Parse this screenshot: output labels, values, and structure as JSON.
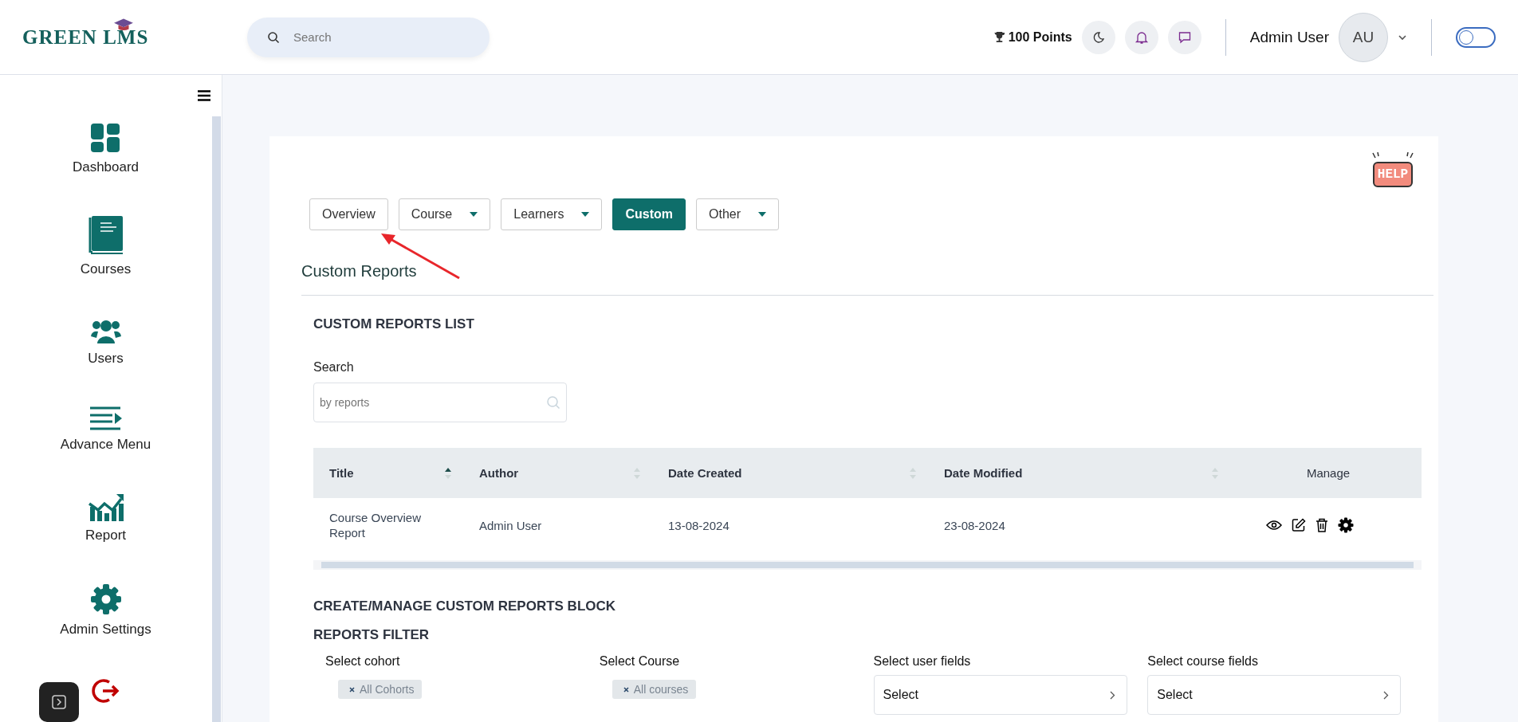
{
  "header": {
    "logo": "GREEN LMS",
    "search": {
      "placeholder": "Search"
    },
    "points": "100 Points",
    "user_name": "Admin User",
    "avatar_initials": "AU",
    "dark_mode_toggle": {
      "on": false
    }
  },
  "sidebar": {
    "items": [
      {
        "label": "Dashboard"
      },
      {
        "label": "Courses"
      },
      {
        "label": "Users"
      },
      {
        "label": "Advance Menu"
      },
      {
        "label": "Report"
      },
      {
        "label": "Admin Settings"
      }
    ]
  },
  "help_badge": "HELP",
  "tabs": [
    {
      "label": "Overview",
      "dropdown": false,
      "selected": false
    },
    {
      "label": "Course",
      "dropdown": true,
      "selected": false
    },
    {
      "label": "Learners",
      "dropdown": true,
      "selected": false
    },
    {
      "label": "Custom",
      "dropdown": false,
      "selected": true
    },
    {
      "label": "Other",
      "dropdown": true,
      "selected": false
    }
  ],
  "page_title": "Custom Reports",
  "list_heading": "CUSTOM REPORTS LIST",
  "search": {
    "label": "Search",
    "placeholder": "by reports"
  },
  "table": {
    "columns": [
      {
        "label": "Title",
        "sorted": true
      },
      {
        "label": "Author",
        "sorted": false
      },
      {
        "label": "Date Created",
        "sorted": false
      },
      {
        "label": "Date Modified",
        "sorted": false
      },
      {
        "label": "Manage"
      }
    ],
    "rows": [
      {
        "cells": [
          "Course Overview Report",
          "Admin User",
          "13-08-2024",
          "23-08-2024"
        ]
      }
    ]
  },
  "block_heading": "CREATE/MANAGE CUSTOM REPORTS BLOCK",
  "filter_heading": "REPORTS FILTER",
  "filters": [
    {
      "label": "Select cohort",
      "kind": "chips",
      "chips": [
        "All Cohorts"
      ]
    },
    {
      "label": "Select Course",
      "kind": "chips",
      "chips": [
        "All courses"
      ]
    },
    {
      "label": "Select user fields",
      "kind": "select",
      "value": "Select"
    },
    {
      "label": "Select course fields",
      "kind": "select",
      "value": "Select"
    }
  ]
}
